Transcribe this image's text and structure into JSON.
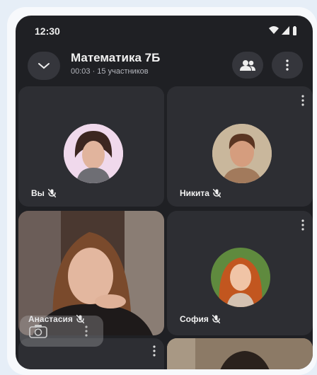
{
  "status_bar": {
    "time": "12:30"
  },
  "header": {
    "title": "Математика 7Б",
    "subtitle": "00:03 · 15 участников"
  },
  "participants": [
    {
      "name": "Вы"
    },
    {
      "name": "Никита"
    },
    {
      "name": "Анастасия"
    },
    {
      "name": "София"
    }
  ],
  "colors": {
    "screen_bg": "#1f2024",
    "tile_bg": "#2d2e33",
    "button_bg": "#35363c"
  }
}
